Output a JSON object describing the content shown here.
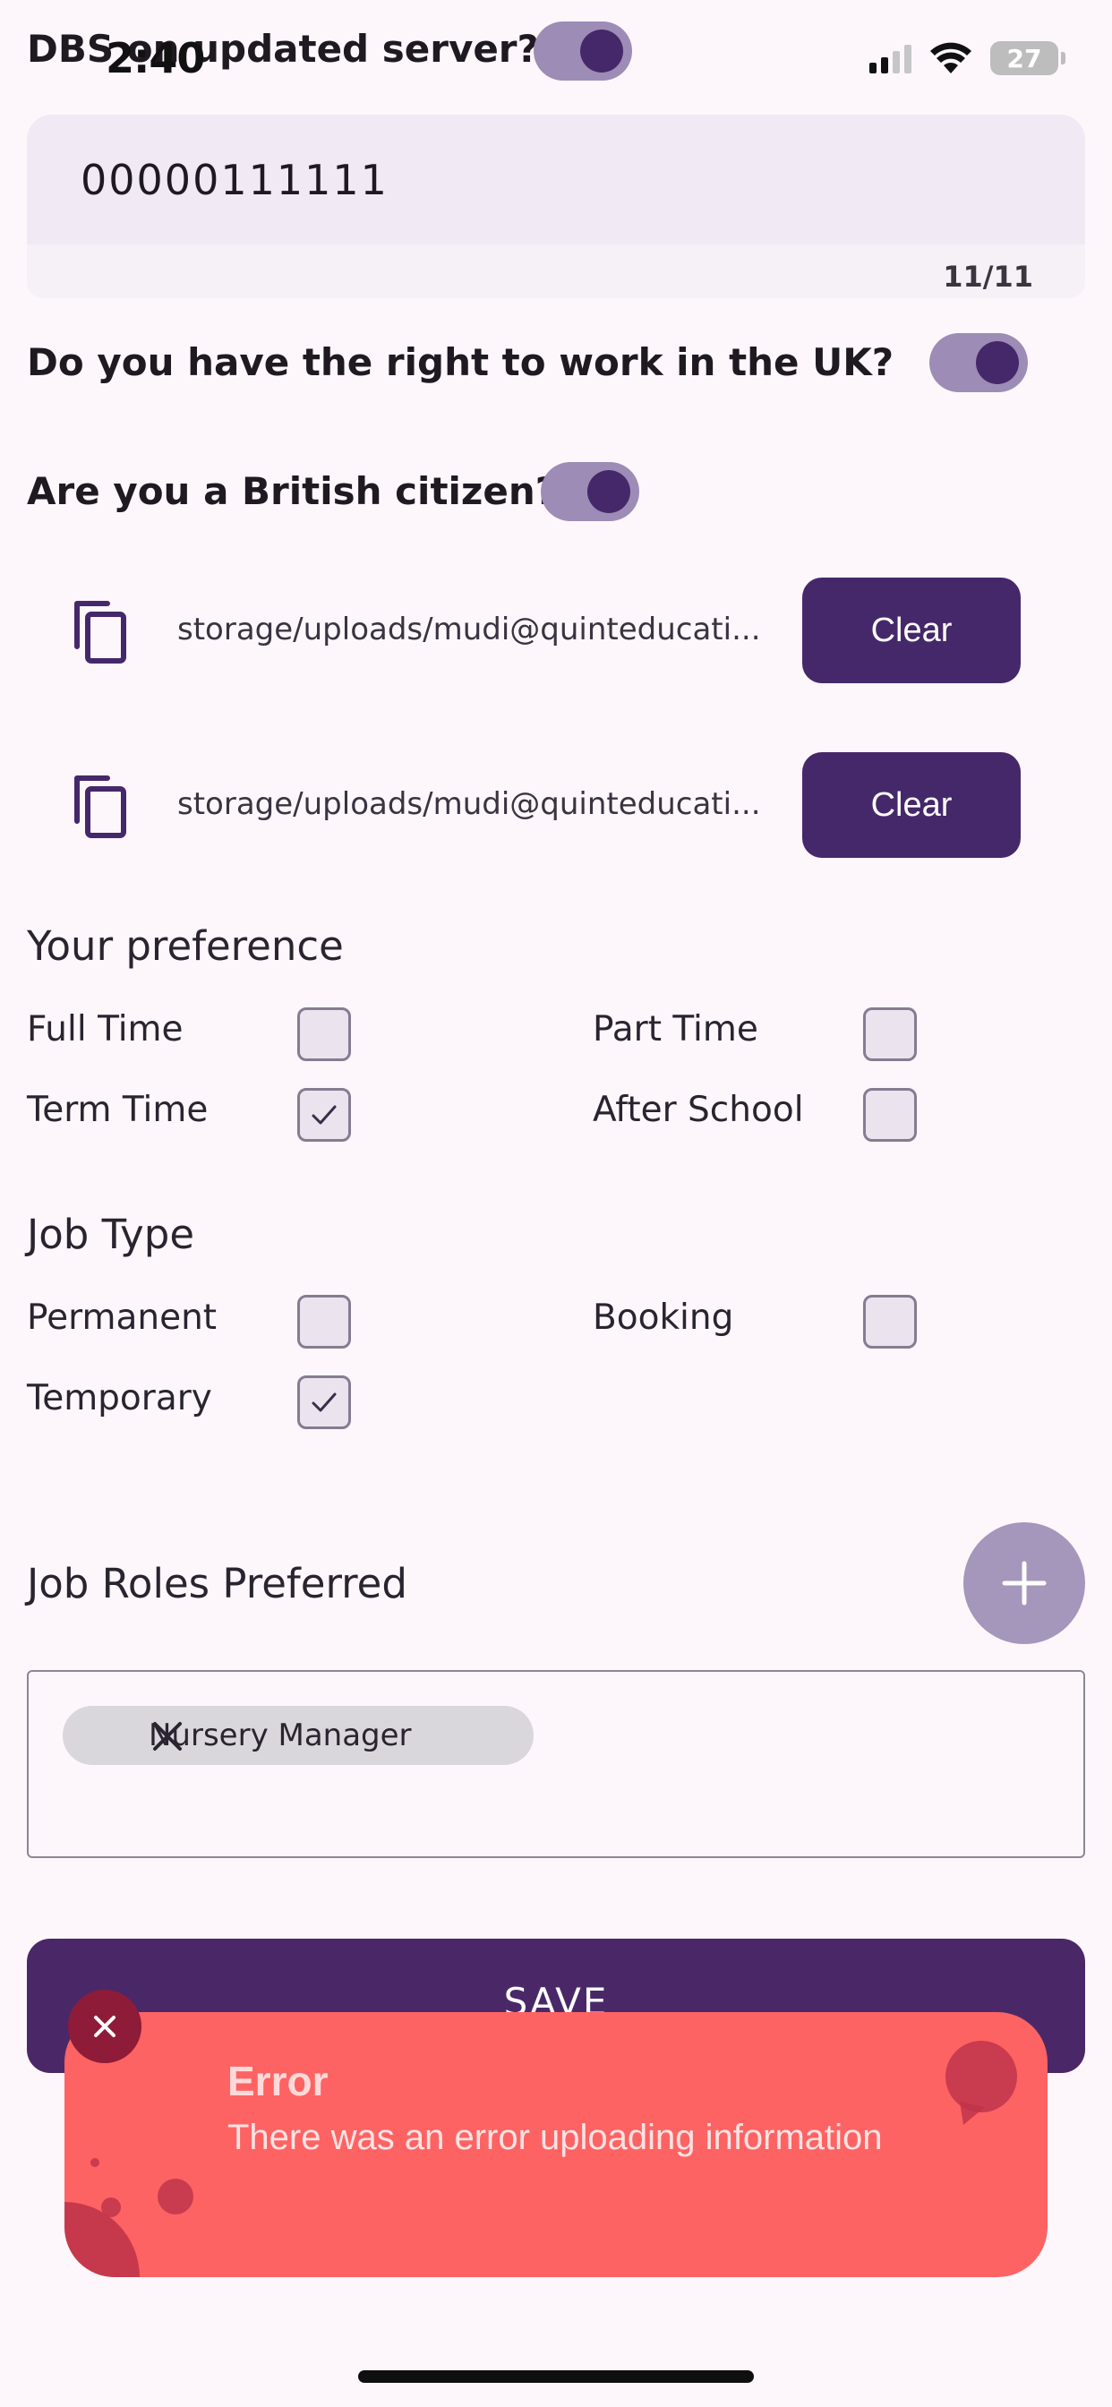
{
  "status_bar": {
    "time": "2:40",
    "battery": "27"
  },
  "dbs": {
    "label": "DBS on updated server?",
    "toggle_on": true
  },
  "number_field": {
    "value": "00000111111",
    "counter": "11/11"
  },
  "right_to_work": {
    "label": "Do you have the right to work in the UK?",
    "toggle_on": true
  },
  "british_citizen": {
    "label": "Are you a British citizen?",
    "toggle_on": true
  },
  "files": [
    {
      "path": "storage/uploads/mudi@quinteducati...",
      "clear_label": "Clear",
      "icon": "copy-icon"
    },
    {
      "path": "storage/uploads/mudi@quinteducati...",
      "clear_label": "Clear",
      "icon": "copy-icon"
    }
  ],
  "preference": {
    "title": "Your preference",
    "options": [
      {
        "label": "Full Time",
        "checked": false
      },
      {
        "label": "Part Time",
        "checked": false
      },
      {
        "label": "Term Time",
        "checked": true
      },
      {
        "label": "After School",
        "checked": false
      }
    ]
  },
  "job_type": {
    "title": "Job Type",
    "options": [
      {
        "label": "Permanent",
        "checked": false
      },
      {
        "label": "Booking",
        "checked": false
      },
      {
        "label": "Temporary",
        "checked": true
      }
    ]
  },
  "job_roles": {
    "title": "Job Roles Preferred",
    "add_icon": "plus-icon",
    "chips": [
      {
        "label": "Nursery Manager",
        "icon": "close-icon"
      }
    ]
  },
  "save": {
    "label": "SAVE"
  },
  "toast": {
    "title": "Error",
    "message": "There was an error uploading information",
    "close_icon": "close-icon",
    "color": "#fe6363"
  },
  "colors": {
    "primary": "#45286a",
    "toggle_track": "#9d8cb5",
    "background": "#fdf7fc"
  }
}
